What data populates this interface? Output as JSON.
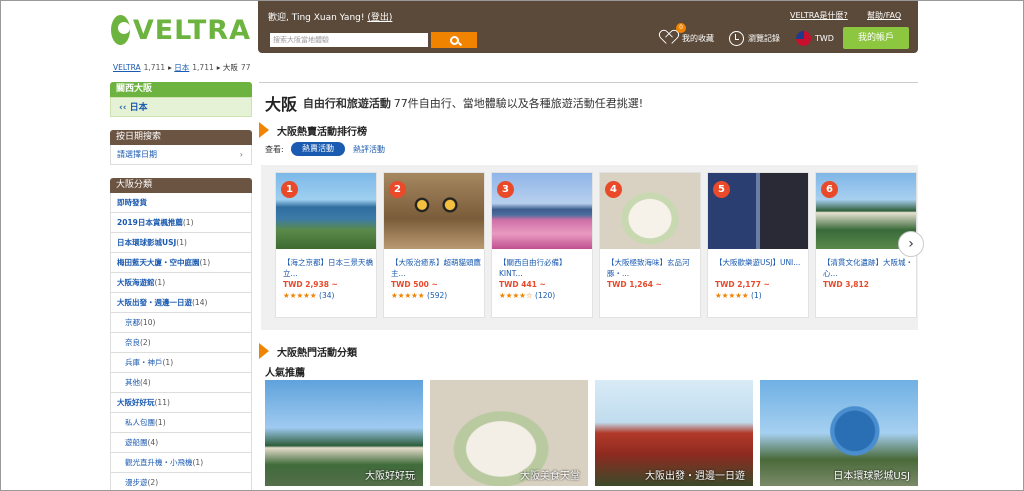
{
  "header": {
    "logo_text": "VELTRA",
    "welcome": "歡迎, Ting Xuan Yang!",
    "logout": "(登出)",
    "search_placeholder": "搜索大阪當地體驗",
    "link_about": "VELTRA是什麼?",
    "link_help": "幫助/FAQ",
    "favorites": "我的收藏",
    "favorites_count": "0",
    "history": "瀏覽記錄",
    "currency": "TWD",
    "account": "我的帳戶"
  },
  "breadcrumb": {
    "root": "VELTRA",
    "root_count": "1,711",
    "country": "日本",
    "country_count": "1,711",
    "city": "大阪",
    "city_count": "77"
  },
  "sidebar": {
    "region": "關西大阪",
    "country": "日本",
    "date_head": "按日期搜索",
    "date_pick": "請選擇日期",
    "cat_head": "大阪分類",
    "categories": [
      {
        "label": "即時發貨",
        "count": "",
        "sub": false
      },
      {
        "label": "2019日本賞楓推薦",
        "count": "(1)",
        "sub": false
      },
      {
        "label": "日本環球影城USJ",
        "count": "(1)",
        "sub": false
      },
      {
        "label": "梅田藍天大廈・空中庭園",
        "count": "(1)",
        "sub": false
      },
      {
        "label": "大阪海遊館",
        "count": "(1)",
        "sub": false
      },
      {
        "label": "大阪出發・週邊一日遊",
        "count": "(14)",
        "sub": false
      },
      {
        "label": "京都",
        "count": "(10)",
        "sub": true
      },
      {
        "label": "奈良",
        "count": "(2)",
        "sub": true
      },
      {
        "label": "兵庫・神戶",
        "count": "(1)",
        "sub": true
      },
      {
        "label": "其他",
        "count": "(4)",
        "sub": true
      },
      {
        "label": "大阪好好玩",
        "count": "(11)",
        "sub": false
      },
      {
        "label": "私人包團",
        "count": "(1)",
        "sub": true
      },
      {
        "label": "遊船團",
        "count": "(4)",
        "sub": true
      },
      {
        "label": "觀光直升機・小飛機",
        "count": "(1)",
        "sub": true
      },
      {
        "label": "漫步遊",
        "count": "(2)",
        "sub": true
      }
    ]
  },
  "main": {
    "city": "大阪",
    "subtitle": "自由行和旅遊活動",
    "tagline": "77件自由行、當地體驗以及各種旅遊活動任君挑選!",
    "ranking_title": "大阪熱賣活動排行榜",
    "view_label": "查看:",
    "tab_hot": "熱賣活動",
    "tab_review": "熱評活動",
    "next_glyph": "›",
    "popular_title": "大阪熱門活動分類",
    "popular_sub": "人氣推薦"
  },
  "ranking": [
    {
      "rank": "1",
      "name": "【海之京都】日本三景天橋立...",
      "price": "TWD 2,938 ~",
      "stars": "★★★★★",
      "reviews": "(34)"
    },
    {
      "rank": "2",
      "name": "【大阪治癒系】超萌貓頭鷹主...",
      "price": "TWD 500 ~",
      "stars": "★★★★★",
      "reviews": "(592)"
    },
    {
      "rank": "3",
      "name": "【關西自由行必備】KINT...",
      "price": "TWD 441 ~",
      "stars": "★★★★☆",
      "reviews": "(120)"
    },
    {
      "rank": "4",
      "name": "【大阪極致海味】玄品河豚・...",
      "price": "TWD 1,264 ~",
      "stars": "",
      "reviews": ""
    },
    {
      "rank": "5",
      "name": "【大阪歡樂遊USJ】UNI...",
      "price": "TWD 2,177 ~",
      "stars": "★★★★★",
      "reviews": "(1)"
    },
    {
      "rank": "6",
      "name": "【清貫文化遺跡】大阪城・心...",
      "price": "TWD 3,812",
      "stars": "",
      "reviews": ""
    }
  ],
  "tiles": [
    {
      "label": "大阪好好玩"
    },
    {
      "label": "大阪美食天堂"
    },
    {
      "label": "大阪出發・週邊一日遊"
    },
    {
      "label": "日本環球影城USJ"
    }
  ],
  "colors": {
    "brand_green": "#6db33f",
    "header_brown": "#5b4a3a",
    "accent_orange": "#f08300",
    "link_blue": "#1a5ab0"
  }
}
